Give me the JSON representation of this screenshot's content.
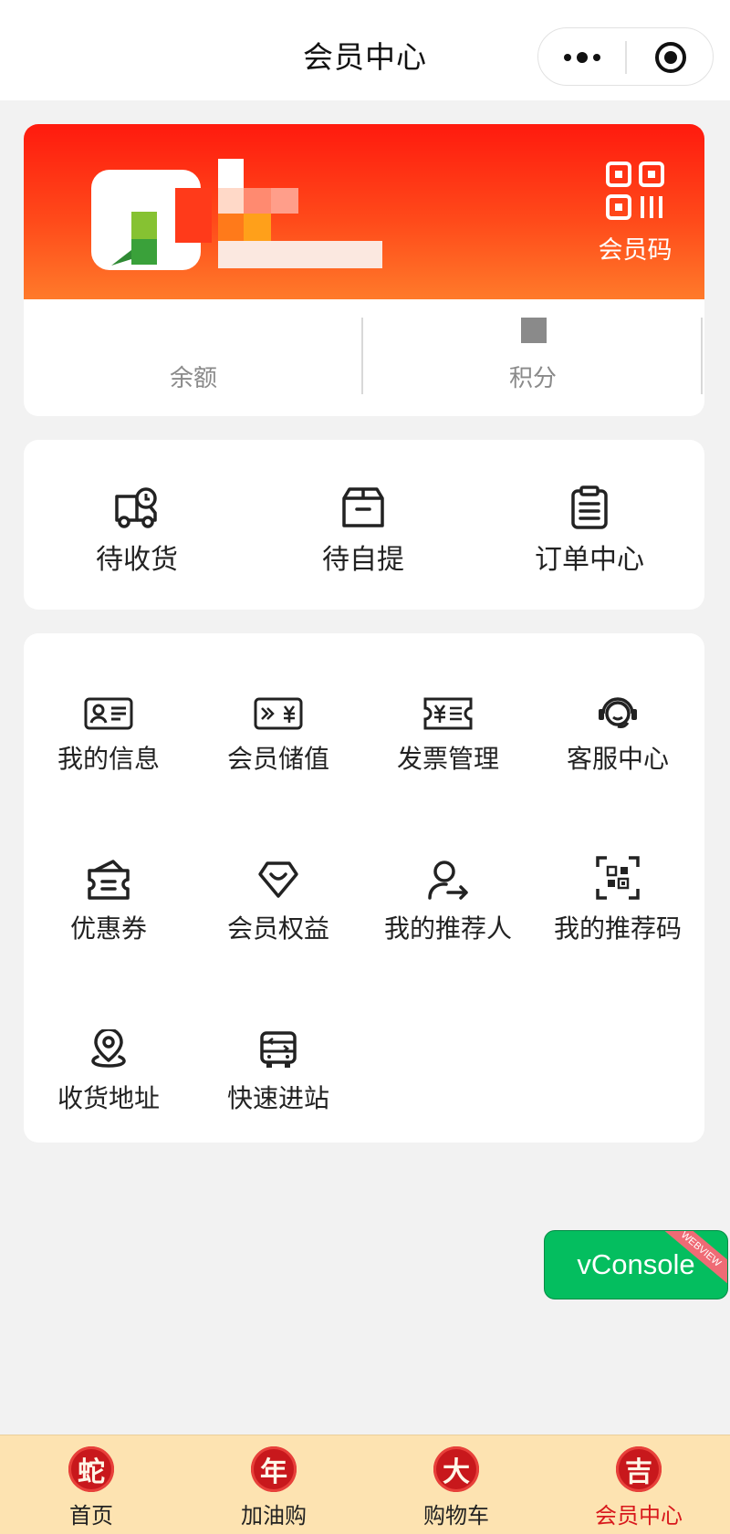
{
  "header": {
    "title": "会员中心",
    "more_icon": "more-dots-icon",
    "close_icon": "target-circle-icon"
  },
  "member_card": {
    "qr_label": "会员码",
    "qr_icon": "qr-code-icon",
    "stats": [
      {
        "label": "余额",
        "value": ""
      },
      {
        "label": "积分",
        "value": ""
      }
    ],
    "banner_color": "#ff2a12"
  },
  "orders": [
    {
      "label": "待收货",
      "icon": "delivery-truck-icon"
    },
    {
      "label": "待自提",
      "icon": "package-box-icon"
    },
    {
      "label": "订单中心",
      "icon": "clipboard-list-icon"
    }
  ],
  "services": [
    {
      "label": "我的信息",
      "icon": "id-card-icon"
    },
    {
      "label": "会员储值",
      "icon": "stored-value-card-icon"
    },
    {
      "label": "发票管理",
      "icon": "invoice-ticket-icon"
    },
    {
      "label": "客服中心",
      "icon": "headset-icon"
    },
    {
      "label": "优惠券",
      "icon": "coupon-icon"
    },
    {
      "label": "会员权益",
      "icon": "benefit-shield-icon"
    },
    {
      "label": "我的推荐人",
      "icon": "user-referral-icon"
    },
    {
      "label": "我的推荐码",
      "icon": "scan-qr-icon"
    },
    {
      "label": "收货地址",
      "icon": "location-pin-icon"
    },
    {
      "label": "快速进站",
      "icon": "bus-station-icon"
    }
  ],
  "vconsole": {
    "label": "vConsole",
    "ribbon": "WEBVIEW"
  },
  "tabbar": {
    "active_color": "#d8181c",
    "items": [
      {
        "label": "首页",
        "glyph": "蛇"
      },
      {
        "label": "加油购",
        "glyph": "年"
      },
      {
        "label": "购物车",
        "glyph": "大"
      },
      {
        "label": "会员中心",
        "glyph": "吉"
      }
    ]
  }
}
